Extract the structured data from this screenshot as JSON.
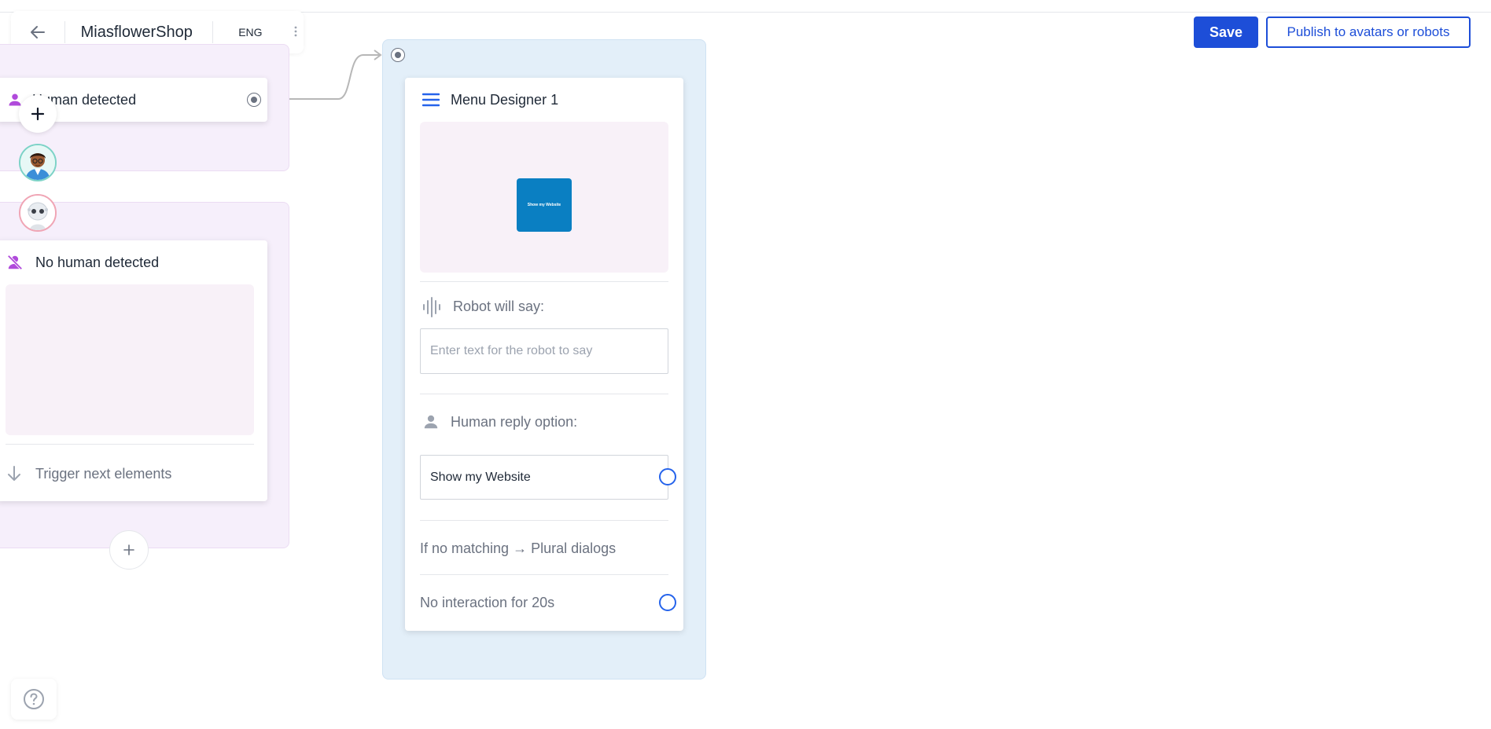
{
  "header": {
    "app_title": "MiasflowerShop",
    "language": "ENG",
    "back_icon": "arrow-left-icon",
    "more_icon": "vertical-dots-icon"
  },
  "toolbar": {
    "save_label": "Save",
    "publish_label": "Publish to avatars or robots"
  },
  "nodes": {
    "human_detected": {
      "title": "Human detected",
      "icon": "person-icon"
    },
    "no_human_detected": {
      "title": "No human detected",
      "icon": "person-off-icon",
      "trigger_label": "Trigger next elements"
    }
  },
  "menu_designer": {
    "title": "Menu Designer 1",
    "tile_label": "Show my Website",
    "robot_say_label": "Robot will say:",
    "robot_say_placeholder": "Enter text for the robot to say",
    "human_reply_label": "Human reply option:",
    "human_reply_value": "Show my Website",
    "no_match_label": "If no matching → Plural dialogs",
    "no_interaction_label": "No interaction for 20s"
  },
  "colors": {
    "primary": "#1d4ed8",
    "node_icon": "#b04adb",
    "lavender_panel": "#f6effb",
    "blue_panel": "#e3eff9",
    "tile": "#0a7fc2"
  }
}
